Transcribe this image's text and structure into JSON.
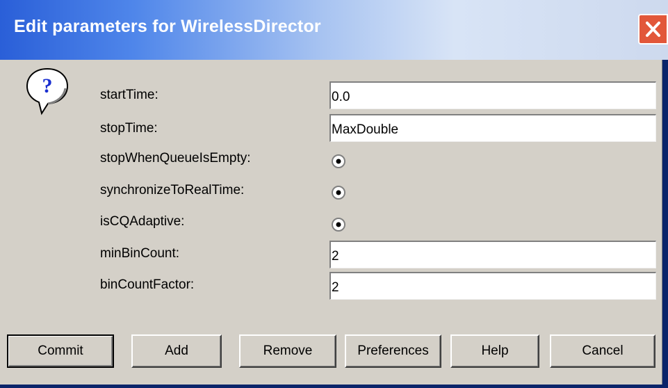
{
  "window": {
    "title": "Edit parameters for WirelessDirector",
    "colors": {
      "titlebar_start": "#2a5fd8",
      "titlebar_end": "#cdd9ee",
      "close": "#e2573a",
      "face": "#d4d0c8"
    },
    "icons": {
      "close": "close-icon",
      "help": "question-icon"
    }
  },
  "params": [
    {
      "label": "startTime:",
      "type": "text",
      "value": "0.0"
    },
    {
      "label": "stopTime:",
      "type": "text",
      "value": "MaxDouble"
    },
    {
      "label": "stopWhenQueueIsEmpty:",
      "type": "radio",
      "checked": true
    },
    {
      "label": "synchronizeToRealTime:",
      "type": "radio",
      "checked": true
    },
    {
      "label": "isCQAdaptive:",
      "type": "radio",
      "checked": true
    },
    {
      "label": "minBinCount:",
      "type": "text",
      "value": "2"
    },
    {
      "label": "binCountFactor:",
      "type": "text",
      "value": "2"
    }
  ],
  "buttons": {
    "commit": "Commit",
    "add": "Add",
    "remove": "Remove",
    "preferences": "Preferences",
    "help": "Help",
    "cancel": "Cancel"
  }
}
